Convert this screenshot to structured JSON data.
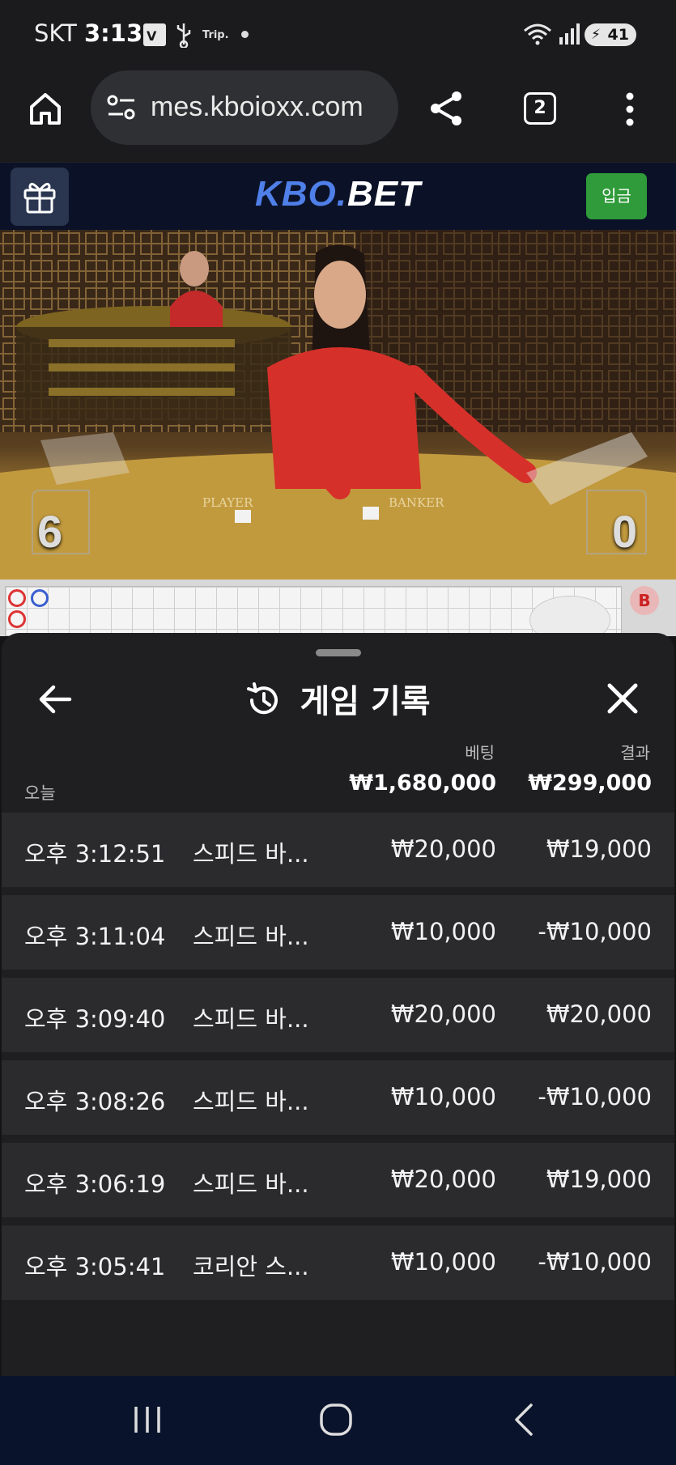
{
  "status_bar": {
    "carrier": "SKT",
    "time": "3:13",
    "trip_label": "Trip.",
    "battery": "41"
  },
  "browser": {
    "url": "mes.kboioxx.com",
    "tab_count": "2"
  },
  "site": {
    "logo_main": "KBO.",
    "logo_accent": "BET",
    "deposit_label": "입금"
  },
  "video": {
    "player_score": "6",
    "banker_score": "0"
  },
  "roadmap": {
    "badge": "B"
  },
  "history": {
    "title": "게임 기록",
    "col_bet": "베팅",
    "col_result": "결과",
    "today_label": "오늘",
    "total_bet": "₩1,680,000",
    "total_result": "₩299,000",
    "rows": [
      {
        "time": "오후 3:12:51",
        "game": "스피드 바...",
        "bet": "₩20,000",
        "result": "₩19,000"
      },
      {
        "time": "오후 3:11:04",
        "game": "스피드 바...",
        "bet": "₩10,000",
        "result": "-₩10,000"
      },
      {
        "time": "오후 3:09:40",
        "game": "스피드 바...",
        "bet": "₩20,000",
        "result": "₩20,000"
      },
      {
        "time": "오후 3:08:26",
        "game": "스피드 바...",
        "bet": "₩10,000",
        "result": "-₩10,000"
      },
      {
        "time": "오후 3:06:19",
        "game": "스피드 바...",
        "bet": "₩20,000",
        "result": "₩19,000"
      },
      {
        "time": "오후 3:05:41",
        "game": "코리안 스...",
        "bet": "₩10,000",
        "result": "-₩10,000"
      }
    ]
  },
  "colors": {
    "brand_blue": "#4f7fe8",
    "deposit_green": "#2f9b3a",
    "sheet_bg": "#1f1f21",
    "row_bg": "#2b2b2e"
  },
  "icons": [
    "home-icon",
    "site-settings-icon",
    "share-icon",
    "more-vert-icon",
    "gift-icon",
    "history-icon",
    "back-arrow-icon",
    "close-icon",
    "recents-icon",
    "home-circle-icon",
    "nav-back-icon"
  ]
}
